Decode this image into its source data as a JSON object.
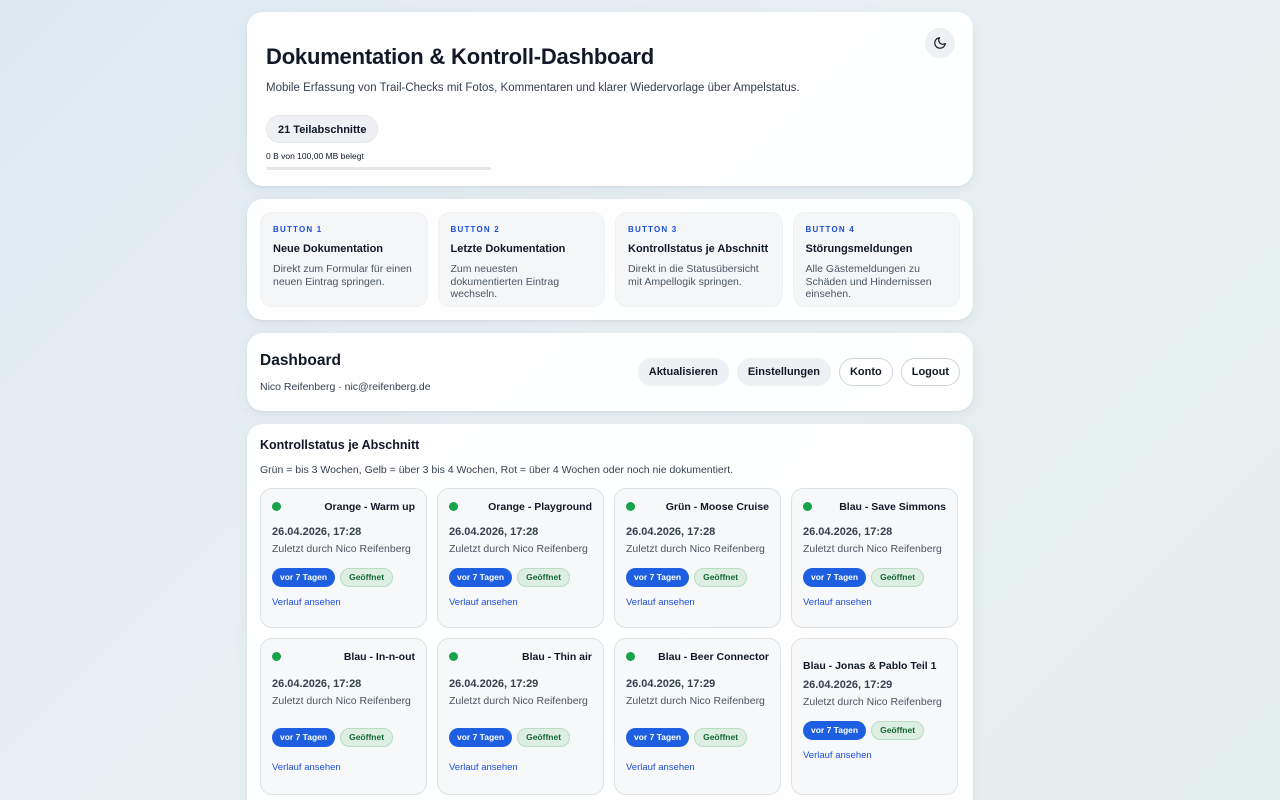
{
  "header": {
    "title": "Dokumentation & Kontroll-Dashboard",
    "subtitle": "Mobile Erfassung von Trail-Checks mit Fotos, Kommentaren und klarer Wiedervorlage über Ampelstatus.",
    "sections_pill": "21 Teilabschnitte",
    "storage_text": "0 B von 100,00 MB belegt",
    "storage_used_fraction": 0,
    "theme_icon": "moon-icon"
  },
  "quick_buttons": [
    {
      "tag": "BUTTON 1",
      "title": "Neue Dokumentation",
      "desc": "Direkt zum Formular für einen neuen Eintrag springen."
    },
    {
      "tag": "BUTTON 2",
      "title": "Letzte Dokumentation",
      "desc": "Zum neuesten dokumentierten Eintrag wechseln."
    },
    {
      "tag": "BUTTON 3",
      "title": "Kontrollstatus je Abschnitt",
      "desc": "Direkt in die Statusübersicht mit Ampellogik springen."
    },
    {
      "tag": "BUTTON 4",
      "title": "Störungsmeldungen",
      "desc": "Alle Gästemeldungen zu Schäden und Hindernissen einsehen."
    }
  ],
  "dashboard": {
    "title": "Dashboard",
    "user": "Nico Reifenberg · nic@reifenberg.de",
    "actions": {
      "refresh": "Aktualisieren",
      "settings": "Einstellungen",
      "account": "Konto",
      "logout": "Logout"
    }
  },
  "status": {
    "title": "Kontrollstatus je Abschnitt",
    "legend": "Grün = bis 3 Wochen, Gelb = über 3 bis 4 Wochen, Rot = über 4 Wochen oder noch nie dokumentiert.",
    "status_color": "#16a34a",
    "sections": [
      {
        "name": "Orange - Warm up",
        "date": "26.04.2026, 17:28",
        "by": "Zuletzt durch Nico Reifenberg",
        "age": "vor 7 Tagen",
        "state": "Geöffnet",
        "link": "Verlauf ansehen"
      },
      {
        "name": "Orange - Playground",
        "date": "26.04.2026, 17:28",
        "by": "Zuletzt durch Nico Reifenberg",
        "age": "vor 7 Tagen",
        "state": "Geöffnet",
        "link": "Verlauf ansehen"
      },
      {
        "name": "Grün - Moose Cruise",
        "date": "26.04.2026, 17:28",
        "by": "Zuletzt durch Nico Reifenberg",
        "age": "vor 7 Tagen",
        "state": "Geöffnet",
        "link": "Verlauf ansehen"
      },
      {
        "name": "Blau - Save Simmons",
        "date": "26.04.2026, 17:28",
        "by": "Zuletzt durch Nico Reifenberg",
        "age": "vor 7 Tagen",
        "state": "Geöffnet",
        "link": "Verlauf ansehen"
      },
      {
        "name": "Blau - In-n-out",
        "date": "26.04.2026, 17:28",
        "by": "Zuletzt durch Nico Reifenberg",
        "age": "vor 7 Tagen",
        "state": "Geöffnet",
        "link": "Verlauf ansehen"
      },
      {
        "name": "Blau - Thin air",
        "date": "26.04.2026, 17:29",
        "by": "Zuletzt durch Nico Reifenberg",
        "age": "vor 7 Tagen",
        "state": "Geöffnet",
        "link": "Verlauf ansehen"
      },
      {
        "name": "Blau - Beer Connector",
        "date": "26.04.2026, 17:29",
        "by": "Zuletzt durch Nico Reifenberg",
        "age": "vor 7 Tagen",
        "state": "Geöffnet",
        "link": "Verlauf ansehen"
      },
      {
        "name": "Blau - Jonas & Pablo Teil 1",
        "date": "26.04.2026, 17:29",
        "by": "Zuletzt durch Nico Reifenberg",
        "age": "vor 7 Tagen",
        "state": "Geöffnet",
        "link": "Verlauf ansehen"
      }
    ]
  }
}
